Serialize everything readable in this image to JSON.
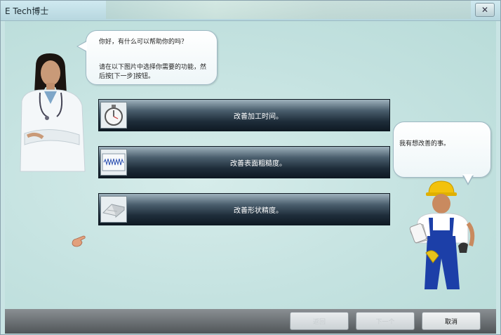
{
  "window": {
    "title": "E Tech博士",
    "close_label": "✕"
  },
  "doctor_bubble": {
    "greeting": "你好，有什么可以帮助你的吗？",
    "instruction": "请在以下图片中选择你需要的功能，然后按[下一步]按钮。"
  },
  "worker_bubble": {
    "text": "我有想改善的事。"
  },
  "options": [
    {
      "label": "改善加工时间。",
      "icon": "stopwatch-icon"
    },
    {
      "label": "改善表面粗糙度。",
      "icon": "surface-roughness-icon"
    },
    {
      "label": "改善形状精度。",
      "icon": "shape-accuracy-icon"
    }
  ],
  "footer": {
    "back_label": "返回",
    "next_label": "下一个",
    "cancel_label": "取消"
  },
  "colors": {
    "background": "#c9e4e4",
    "option_dark": "#0f1a24",
    "footer": "#505558"
  }
}
